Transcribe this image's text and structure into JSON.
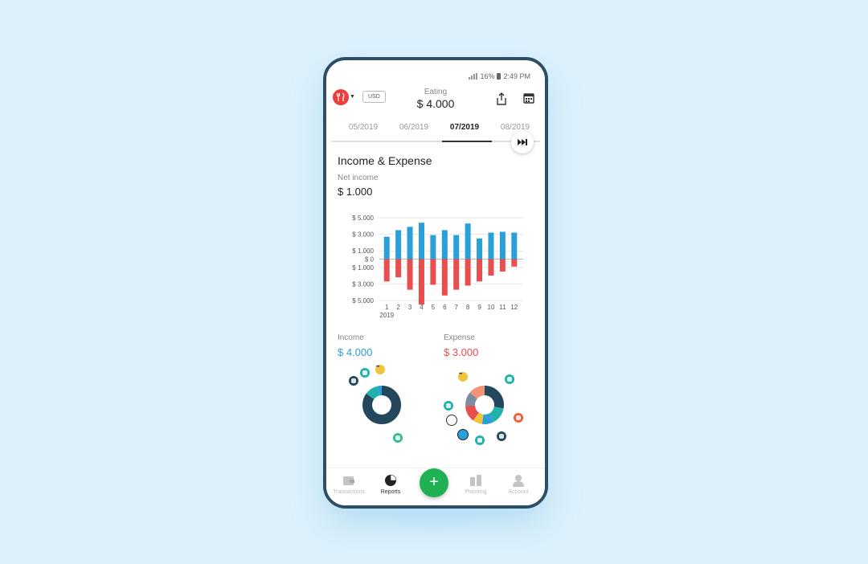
{
  "status_bar": {
    "battery": "16%",
    "time": "2:49 PM"
  },
  "header": {
    "category_label": "Eating",
    "amount": "$ 4.000",
    "currency": "USD"
  },
  "tabs": [
    {
      "label": "05/2019",
      "active": false
    },
    {
      "label": "06/2019",
      "active": false
    },
    {
      "label": "07/2019",
      "active": true
    },
    {
      "label": "08/2019",
      "active": false
    }
  ],
  "report": {
    "title": "Income & Expense",
    "net_label": "Net income",
    "net_value": "$ 1.000"
  },
  "chart_data": {
    "type": "bar",
    "categories": [
      "1",
      "2",
      "3",
      "4",
      "5",
      "6",
      "7",
      "8",
      "9",
      "10",
      "11",
      "12"
    ],
    "x_sublabel": "2019",
    "y_tick_labels": [
      "$ 5.000",
      "$ 3.000",
      "$ 1.000",
      "$ 0",
      "$ 1.000",
      "$ 3.000",
      "$ 5.000"
    ],
    "y_tick_values": [
      5000,
      3000,
      1000,
      0,
      -1000,
      -3000,
      -5000
    ],
    "ylim": [
      -5000,
      5000
    ],
    "series": [
      {
        "color": "#2a9fd8",
        "values": [
          2700,
          3500,
          3900,
          4400,
          2900,
          3500,
          2900,
          4300,
          2500,
          3200,
          3300,
          3200
        ]
      },
      {
        "color": "#e94e4e",
        "values": [
          -2700,
          -2200,
          -3700,
          -5500,
          -3100,
          -4400,
          -3700,
          -3200,
          -2700,
          -2000,
          -1500,
          -900
        ]
      }
    ],
    "grid": true
  },
  "summary": {
    "income_label": "Income",
    "income_value": "$ 4.000",
    "expense_label": "Expense",
    "expense_value": "$ 3.000"
  },
  "income_donut": [
    {
      "value": 85,
      "color": "#23485e"
    },
    {
      "value": 11,
      "color": "#20b2aa"
    },
    {
      "value": 4,
      "color": "#2a9fd8"
    }
  ],
  "expense_donut": [
    {
      "value": 28,
      "color": "#23485e"
    },
    {
      "value": 14,
      "color": "#20b2aa"
    },
    {
      "value": 10,
      "color": "#2a9fd8"
    },
    {
      "value": 8,
      "color": "#f0c43c"
    },
    {
      "value": 14,
      "color": "#e94e4e"
    },
    {
      "value": 12,
      "color": "#7d8da0"
    },
    {
      "value": 14,
      "color": "#f29474"
    }
  ],
  "bottom_nav": [
    {
      "label": "Transactions",
      "icon": "wallet-icon",
      "active": false
    },
    {
      "label": "Reports",
      "icon": "pie-chart-icon",
      "active": true
    },
    {
      "label": "Planning",
      "icon": "planning-icon",
      "active": false
    },
    {
      "label": "Account",
      "icon": "person-icon",
      "active": false
    }
  ],
  "fab": {
    "icon": "plus-icon",
    "label": "+"
  },
  "colors": {
    "income": "#2a9fd8",
    "expense": "#e94e4e",
    "fab": "#1fb153",
    "frame": "#2c4f66"
  }
}
